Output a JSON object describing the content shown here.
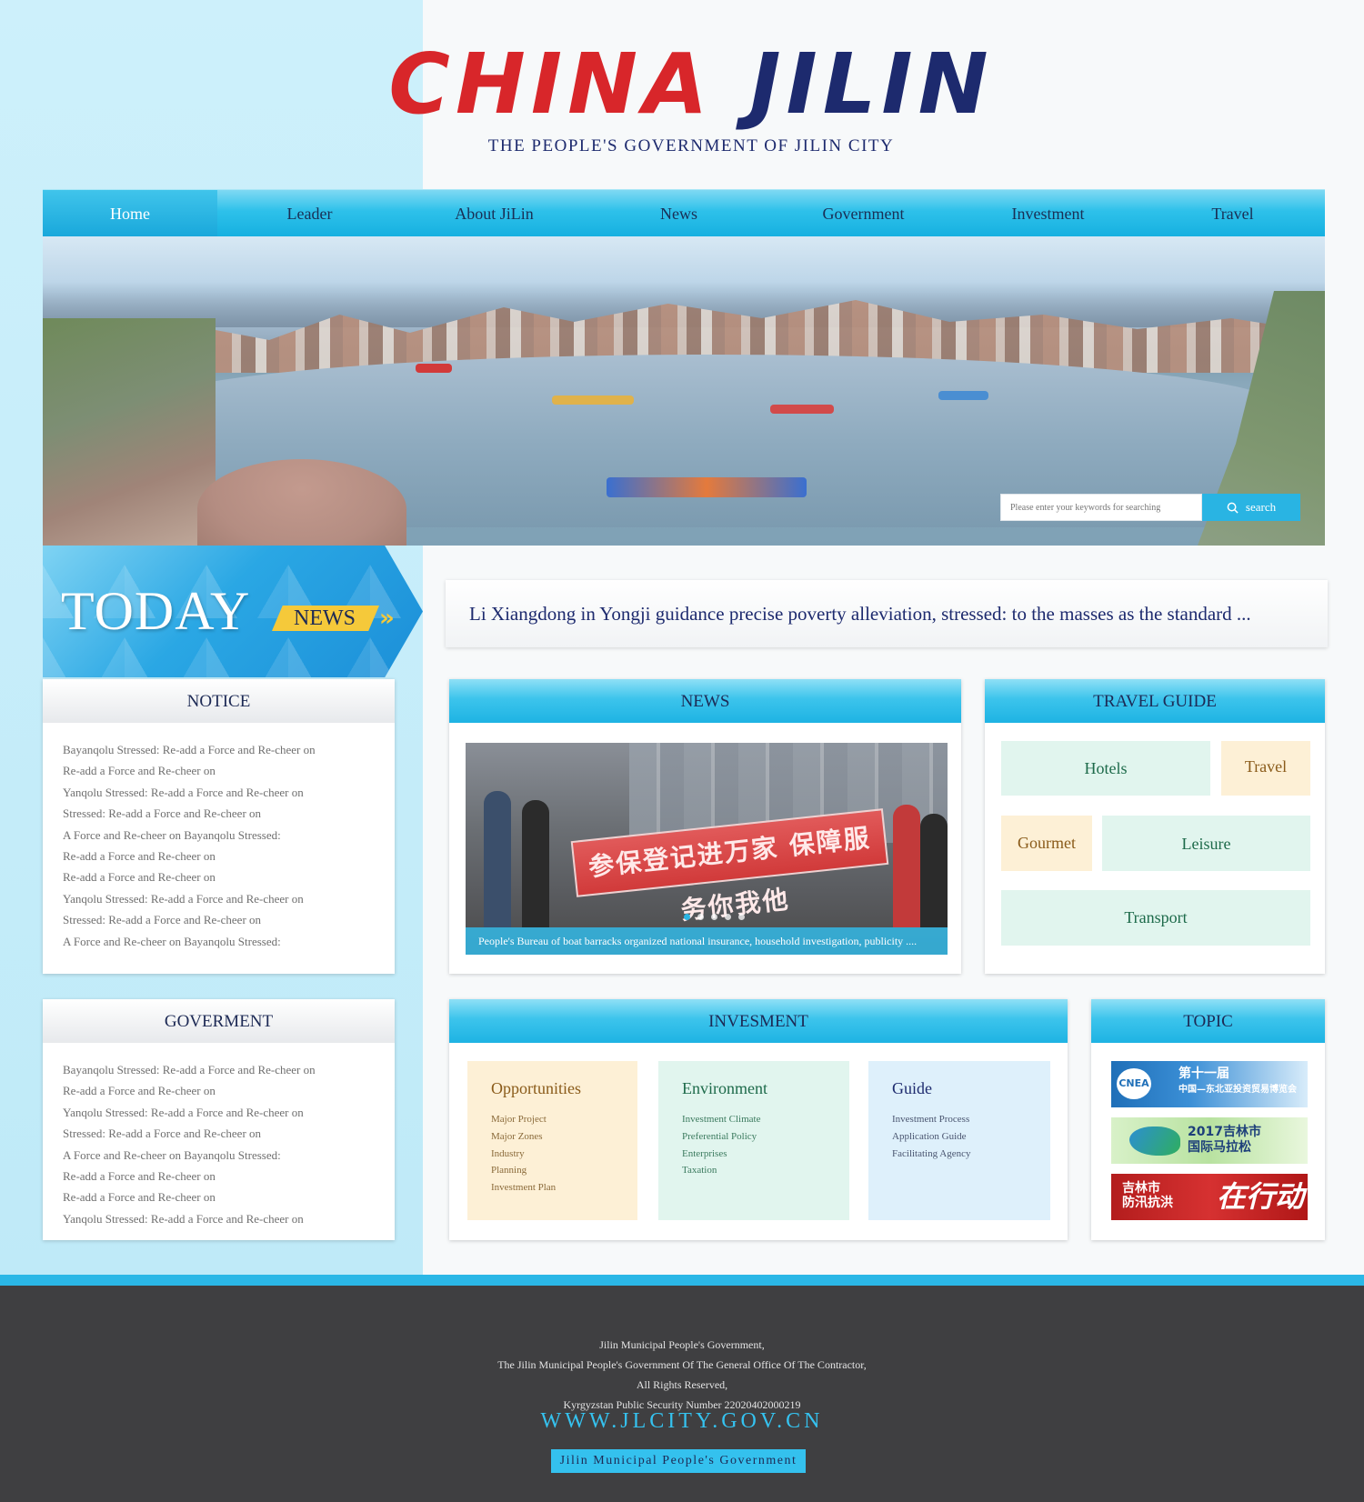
{
  "header": {
    "logo_word1": "CHINA",
    "logo_word2": "JILIN",
    "subtitle": "THE PEOPLE'S GOVERNMENT OF JILIN CITY"
  },
  "nav": {
    "items": [
      "Home",
      "Leader",
      "About JiLin",
      "News",
      "Government",
      "Investment",
      "Travel"
    ],
    "active": "Home"
  },
  "search": {
    "placeholder": "Please enter your keywords for searching",
    "button_label": "search"
  },
  "today": {
    "title": "TODAY",
    "badge": "NEWS"
  },
  "headline": "Li Xiangdong in Yongji guidance precise poverty alleviation, stressed: to the masses as the standard ...",
  "notice": {
    "title": "NOTICE",
    "items": [
      "Bayanqolu Stressed: Re-add a Force and Re-cheer on",
      "Re-add a Force and Re-cheer on",
      "Yanqolu Stressed: Re-add a Force and Re-cheer on",
      "Stressed: Re-add a Force and Re-cheer on",
      "A Force and Re-cheer on Bayanqolu Stressed:",
      "Re-add a Force and Re-cheer on",
      "Re-add a Force and Re-cheer on",
      "Yanqolu Stressed: Re-add a Force and Re-cheer on",
      "Stressed: Re-add a Force and Re-cheer on",
      "A Force and Re-cheer on Bayanqolu Stressed:"
    ]
  },
  "government": {
    "title": "GOVERMENT",
    "items": [
      "Bayanqolu Stressed: Re-add a Force and Re-cheer on",
      "Re-add a Force and Re-cheer on",
      "Yanqolu Stressed: Re-add a Force and Re-cheer on",
      "Stressed: Re-add a Force and Re-cheer on",
      "A Force and Re-cheer on Bayanqolu Stressed:",
      "Re-add a Force and Re-cheer on",
      "Re-add a Force and Re-cheer on",
      "Yanqolu Stressed: Re-add a Force and Re-cheer on"
    ]
  },
  "news": {
    "title": "NEWS",
    "slide_banner_text": "参保登记进万家 保障服务你我他",
    "slide_caption": "People's Bureau of boat barracks organized national insurance, household investigation, publicity ....",
    "dot_count": 5,
    "active_dot": 0
  },
  "travel_guide": {
    "title": "TRAVEL GUIDE",
    "tiles": [
      "Hotels",
      "Travel",
      "Gourmet",
      "Leisure",
      "Transport"
    ]
  },
  "investment": {
    "title": "INVESMENT",
    "cards": [
      {
        "title": "Opportunities",
        "items": [
          "Major Project",
          "Major Zones",
          "Industry",
          "Planning",
          "Investment Plan"
        ]
      },
      {
        "title": "Environment",
        "items": [
          "Investment Climate",
          "Preferential Policy",
          "Enterprises",
          "Taxation"
        ]
      },
      {
        "title": "Guide",
        "items": [
          "Investment Process",
          "Application Guide",
          "Facilitating Agency"
        ]
      }
    ]
  },
  "topic": {
    "title": "TOPIC",
    "banners": [
      {
        "mark": "CNEA",
        "line1": "第十一届",
        "line2": "中国—东北亚投资贸易博览会"
      },
      {
        "line1": "2017吉林市",
        "line2": "国际马拉松"
      },
      {
        "line1": "吉林市",
        "line2": "防汛抗洪",
        "big": "在行动"
      }
    ]
  },
  "footer": {
    "lines": [
      "Jilin Municipal People's Government,",
      "The Jilin Municipal People's Government Of The General Office Of The Contractor,",
      "All Rights Reserved,",
      "Kyrgyzstan Public Security Number 22020402000219"
    ],
    "url": "WWW.JLCITY.GOV.CN",
    "gov_label": "Jilin Municipal People's Government"
  },
  "colors": {
    "accent": "#2bb7e6",
    "logo_red": "#d8262a",
    "logo_navy": "#1d2a6e",
    "footer_bg": "#3f3f41"
  }
}
